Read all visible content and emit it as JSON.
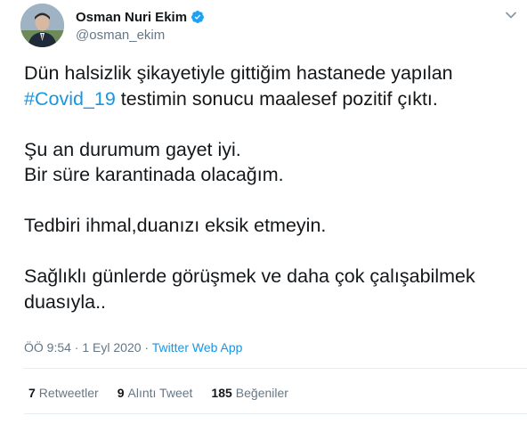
{
  "author": {
    "display_name": "Osman Nuri Ekim",
    "handle": "@osman_ekim",
    "verified": true
  },
  "tweet": {
    "line1": "Dün halsizlik şikayetiyle gittiğim hastanede yapılan",
    "hashtag": "#Covid_19",
    "line2_rest": " testimin sonucu maalesef pozitif çıktı.",
    "line3": "Şu an durumum gayet iyi.",
    "line4": "Bir süre karantinada olacağım.",
    "line5": "Tedbiri ihmal,duanızı eksik etmeyin.",
    "line6": "Sağlıklı günlerde görüşmek ve daha çok çalışabilmek",
    "line7": "duasıyla.."
  },
  "meta": {
    "time": "ÖÖ 9:54",
    "separator1": " · ",
    "date": "1 Eyl 2020",
    "separator2": " · ",
    "source": "Twitter Web App"
  },
  "stats": {
    "retweets_count": "7",
    "retweets_label": "Retweetler",
    "quotes_count": "9",
    "quotes_label": "Alıntı Tweet",
    "likes_count": "185",
    "likes_label": "Beğeniler"
  },
  "colors": {
    "link": "#1b95e0",
    "verified": "#1da1f2",
    "secondary_text": "#657786"
  },
  "icons": {
    "verified": "verified-badge-icon",
    "caret": "chevron-down-icon"
  }
}
